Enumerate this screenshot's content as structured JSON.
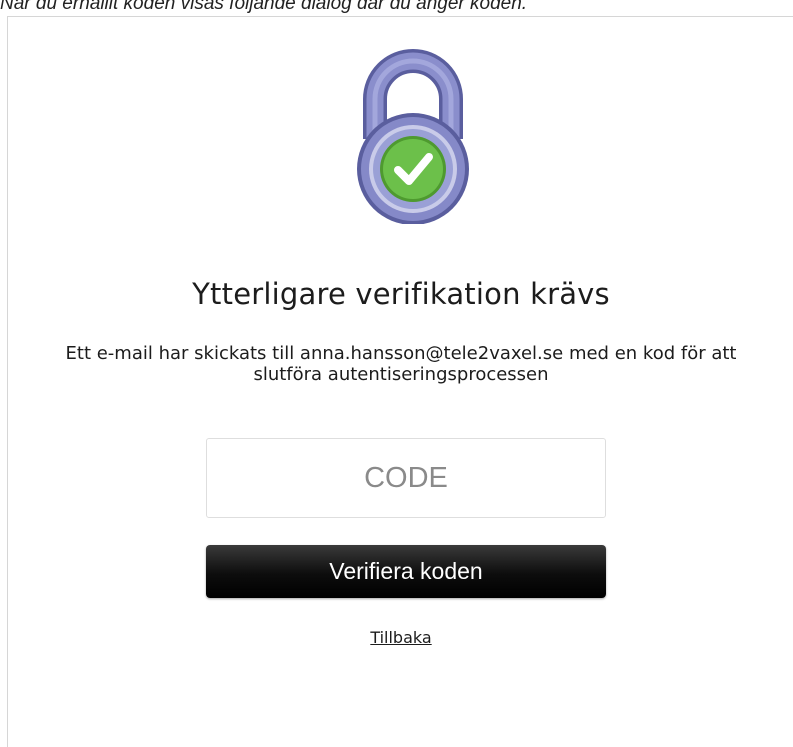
{
  "page": {
    "caption": "När du erhållit koden visas följande dialog där du anger koden."
  },
  "dialog": {
    "icon": "padlock-check-icon",
    "title": "Ytterligare verifikation krävs",
    "message": "Ett e-mail har skickats till anna.hansson@tele2vaxel.se med en kod för att slutföra autentiseringsprocessen",
    "code_input": {
      "placeholder": "CODE",
      "value": ""
    },
    "verify_button_label": "Verifiera koden",
    "back_link_label": "Tillbaka"
  },
  "colors": {
    "lock_body": "#7b7fbf",
    "lock_shackle": "#8185c5",
    "check_circle": "#6cc04a",
    "button_bg": "#0d0d0d"
  }
}
